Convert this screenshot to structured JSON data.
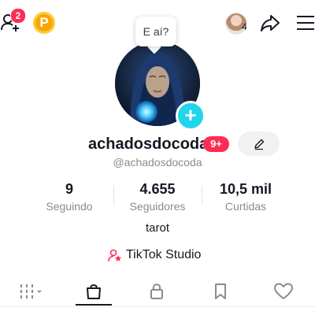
{
  "top_bar": {
    "friend_requests_badge": "2",
    "coin_label": "P",
    "story_count": "4"
  },
  "bubble": {
    "text": "E aí?"
  },
  "profile": {
    "name": "achadosdocoda",
    "badge": "9+",
    "handle": "@achadosdocoda",
    "bio": "tarot"
  },
  "stats": [
    {
      "value": "9",
      "label": "Seguindo"
    },
    {
      "value": "4.655",
      "label": "Seguidores"
    },
    {
      "value": "10,5 mil",
      "label": "Curtidas"
    }
  ],
  "studio": {
    "label": "TikTok Studio"
  },
  "tabs": [
    {
      "icon": "grid-icon",
      "selected": false
    },
    {
      "icon": "shopping-bag-icon",
      "selected": true
    },
    {
      "icon": "lock-icon",
      "selected": false
    },
    {
      "icon": "bookmark-icon",
      "selected": false
    },
    {
      "icon": "heart-icon",
      "selected": false
    }
  ],
  "colors": {
    "accent_red": "#fe2c55",
    "accent_cyan": "#20d5ec",
    "coin": "#f7a600",
    "text": "#161823",
    "muted": "#8a8b91"
  }
}
